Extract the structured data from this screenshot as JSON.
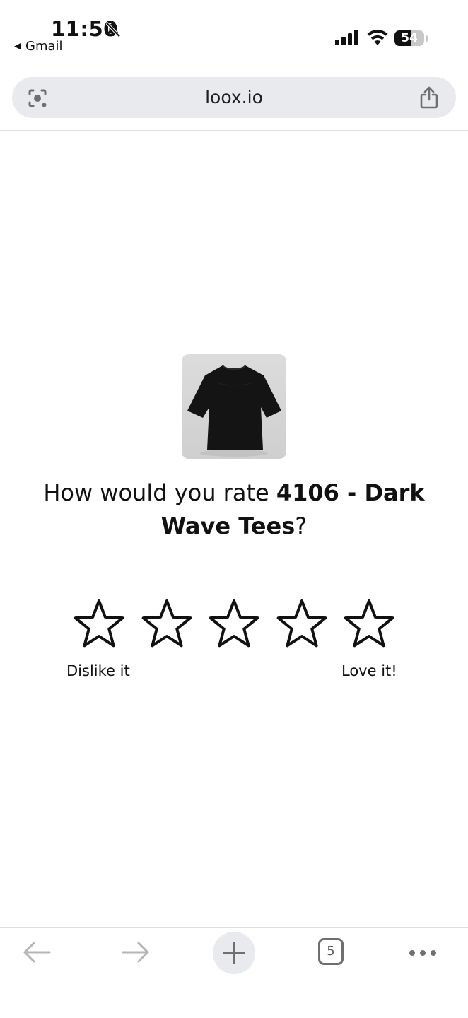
{
  "status_bar": {
    "time": "11:50",
    "back_app": "Gmail",
    "battery_level": 54,
    "battery_text": "54"
  },
  "browser": {
    "url": "loox.io",
    "tab_count": "5"
  },
  "review": {
    "question_prefix": "How would you rate ",
    "product_name": "4106 - Dark Wave Tees",
    "question_suffix": "?",
    "stars": [
      1,
      2,
      3,
      4,
      5
    ],
    "selected_rating": 0,
    "label_low": "Dislike it",
    "label_high": "Love it!"
  },
  "icons": {
    "status": [
      "bell-slash-icon",
      "cell-signal-icon",
      "wifi-icon",
      "battery-icon"
    ],
    "address_bar": [
      "google-lens-icon",
      "share-icon"
    ],
    "toolbar": [
      "back-arrow-icon",
      "forward-arrow-icon",
      "plus-icon",
      "tabs-icon",
      "more-icon"
    ]
  },
  "colors": {
    "text": "#111111",
    "address_bar_bg": "#e8eaed",
    "toolbar_icon": "#6f6f6f",
    "toolbar_icon_disabled": "#b5b5b5",
    "product_tee": "#141414"
  }
}
